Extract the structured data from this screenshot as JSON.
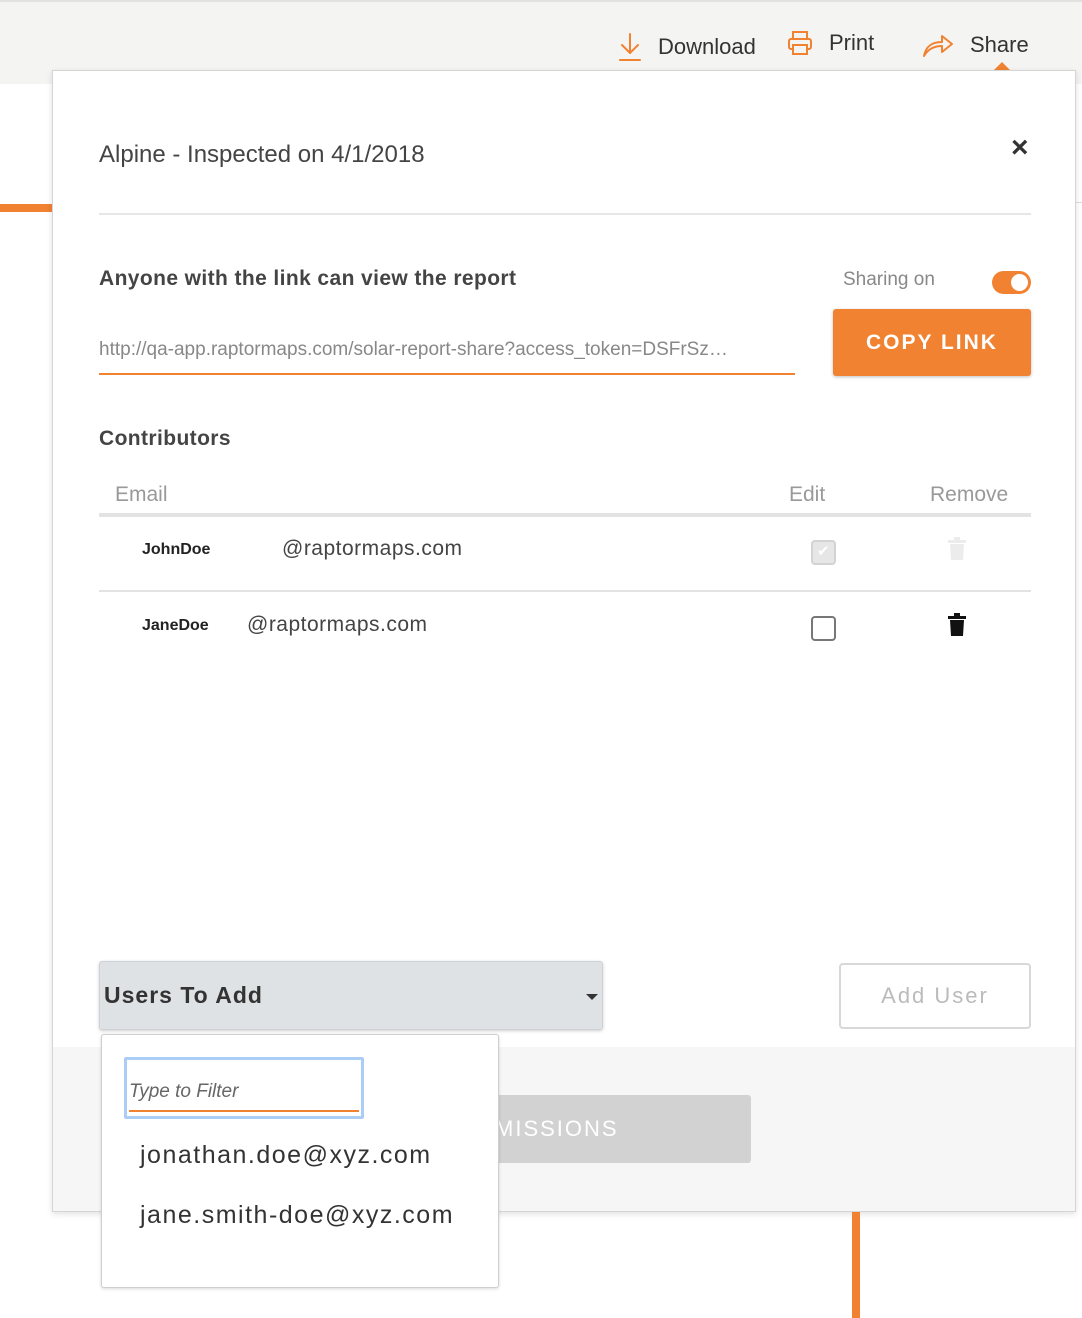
{
  "toolbar": {
    "download_label": "Download",
    "print_label": "Print",
    "share_label": "Share"
  },
  "modal": {
    "title": "Alpine - Inspected on 4/1/2018",
    "close_glyph": "×"
  },
  "link_section": {
    "heading": "Anyone with the link can view the report",
    "sharing_label": "Sharing on",
    "sharing_on": true,
    "link_value": "http://qa-app.raptormaps.com/solar-report-share?access_token=DSFrSz…",
    "copy_label": "COPY LINK"
  },
  "contributors": {
    "heading": "Contributors",
    "columns": {
      "email": "Email",
      "edit": "Edit",
      "remove": "Remove"
    },
    "rows": [
      {
        "name": "JohnDoe",
        "email": "@raptormaps.com",
        "edit_checked": true,
        "edit_disabled": true,
        "remove_disabled": true
      },
      {
        "name": "JaneDoe",
        "email": "@raptormaps.com",
        "edit_checked": false,
        "edit_disabled": false,
        "remove_disabled": false
      }
    ]
  },
  "add_users": {
    "select_label": "Users To Add",
    "add_button_label": "Add User",
    "filter_placeholder": "Type to Filter",
    "options": [
      "jonathan.doe@xyz.com",
      "jane.smith-doe@xyz.com"
    ]
  },
  "footer": {
    "save_label": "E PERMISSIONS"
  },
  "colors": {
    "accent": "#f18232",
    "focus_ring": "#a9cdf4"
  },
  "icons": [
    "download-icon",
    "print-icon",
    "share-icon",
    "close-icon",
    "trash-icon",
    "caret-down-icon"
  ]
}
